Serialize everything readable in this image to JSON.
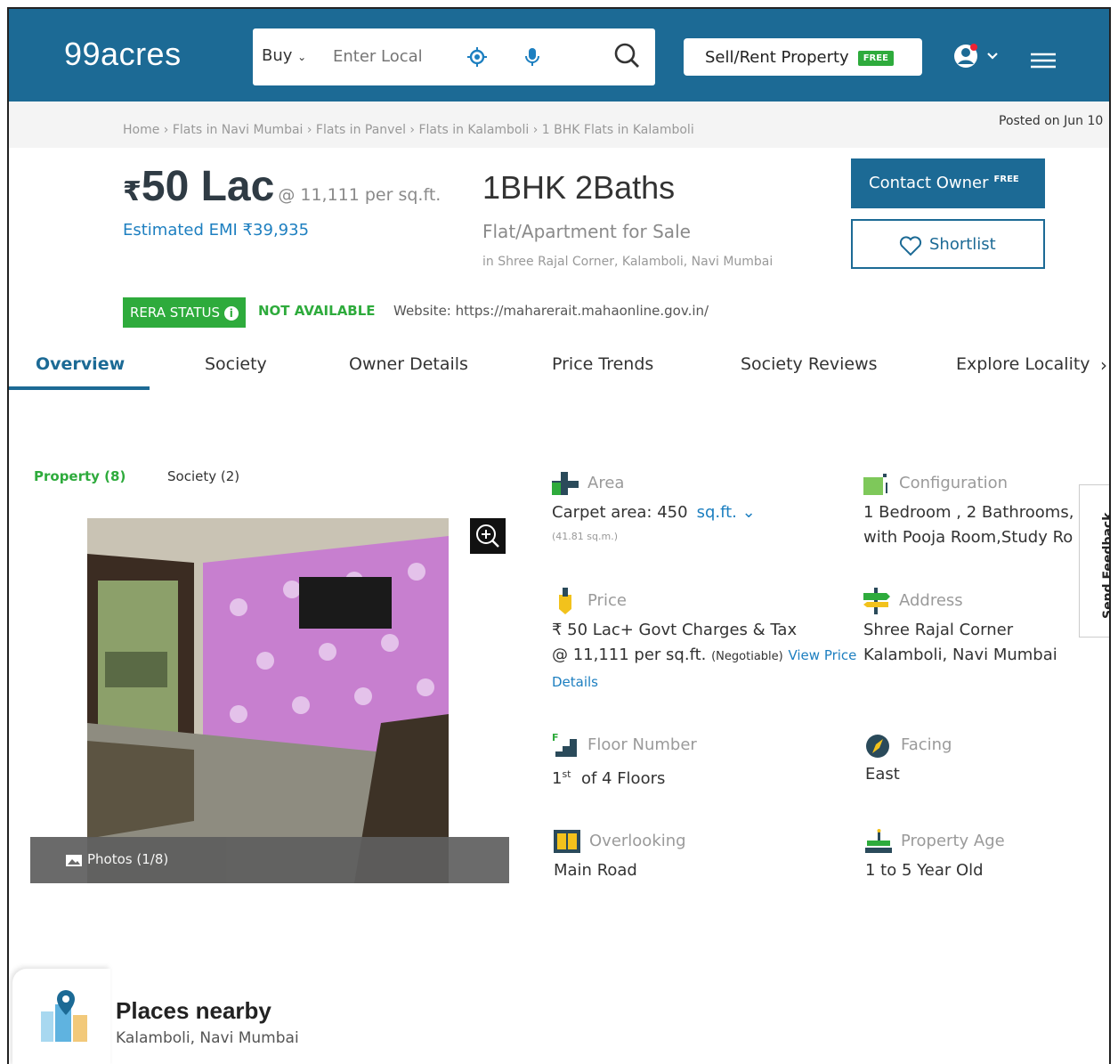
{
  "header": {
    "logo": "99acres",
    "buy_label": "Buy",
    "search_placeholder": "Enter Local",
    "sell_label": "Sell/Rent Property",
    "free_badge": "FREE",
    "brand_color": "#1c6a95"
  },
  "breadcrumb": "Home › Flats in Navi Mumbai › Flats in Panvel › Flats in Kalamboli › 1 BHK Flats in Kalamboli",
  "posted": "Posted on Jun 10",
  "listing": {
    "price_symbol": "₹",
    "price": "50 Lac",
    "price_per": "@ 11,111 per sq.ft.",
    "emi": "Estimated EMI ₹39,935",
    "config": "1BHK 2Baths",
    "type": "Flat/Apartment for Sale",
    "society": "in Shree Rajal Corner, Kalamboli, Navi Mumbai",
    "contact_label": "Contact Owner",
    "contact_badge": "FREE",
    "shortlist_label": "Shortlist"
  },
  "rera": {
    "badge": "RERA STATUS",
    "status": "NOT AVAILABLE",
    "website": "Website: https://maharerait.mahaonline.gov.in/"
  },
  "tabs": [
    "Overview",
    "Society",
    "Owner Details",
    "Price Trends",
    "Society Reviews",
    "Explore Locality"
  ],
  "gallery": {
    "tabs": [
      "Property (8)",
      "Society (2)"
    ],
    "photos_label": "Photos (1/8)"
  },
  "details": {
    "area": {
      "label": "Area",
      "value": "Carpet area: 450",
      "unit": "sq.ft.",
      "sub": "(41.81 sq.m.)"
    },
    "configuration": {
      "label": "Configuration",
      "line1": "1 Bedroom , 2 Bathrooms,",
      "line2": "with Pooja Room,Study Ro"
    },
    "price": {
      "label": "Price",
      "line1": "₹ 50 Lac+ Govt Charges & Tax",
      "line2": "@ 11,111 per sq.ft.",
      "negotiable": "(Negotiable)",
      "link1": "View Price",
      "link2": "Details"
    },
    "address": {
      "label": "Address",
      "line1": "Shree Rajal Corner",
      "line2": "Kalamboli, Navi Mumbai"
    },
    "floor": {
      "label": "Floor Number",
      "value": "1",
      "sup": "st",
      "rest": "of 4 Floors"
    },
    "facing": {
      "label": "Facing",
      "value": "East"
    },
    "overlooking": {
      "label": "Overlooking",
      "value": "Main Road"
    },
    "age": {
      "label": "Property Age",
      "value": "1 to 5 Year Old"
    }
  },
  "feedback": "Send Feedback",
  "nearby": {
    "title": "Places nearby",
    "subtitle": "Kalamboli, Navi Mumbai"
  }
}
